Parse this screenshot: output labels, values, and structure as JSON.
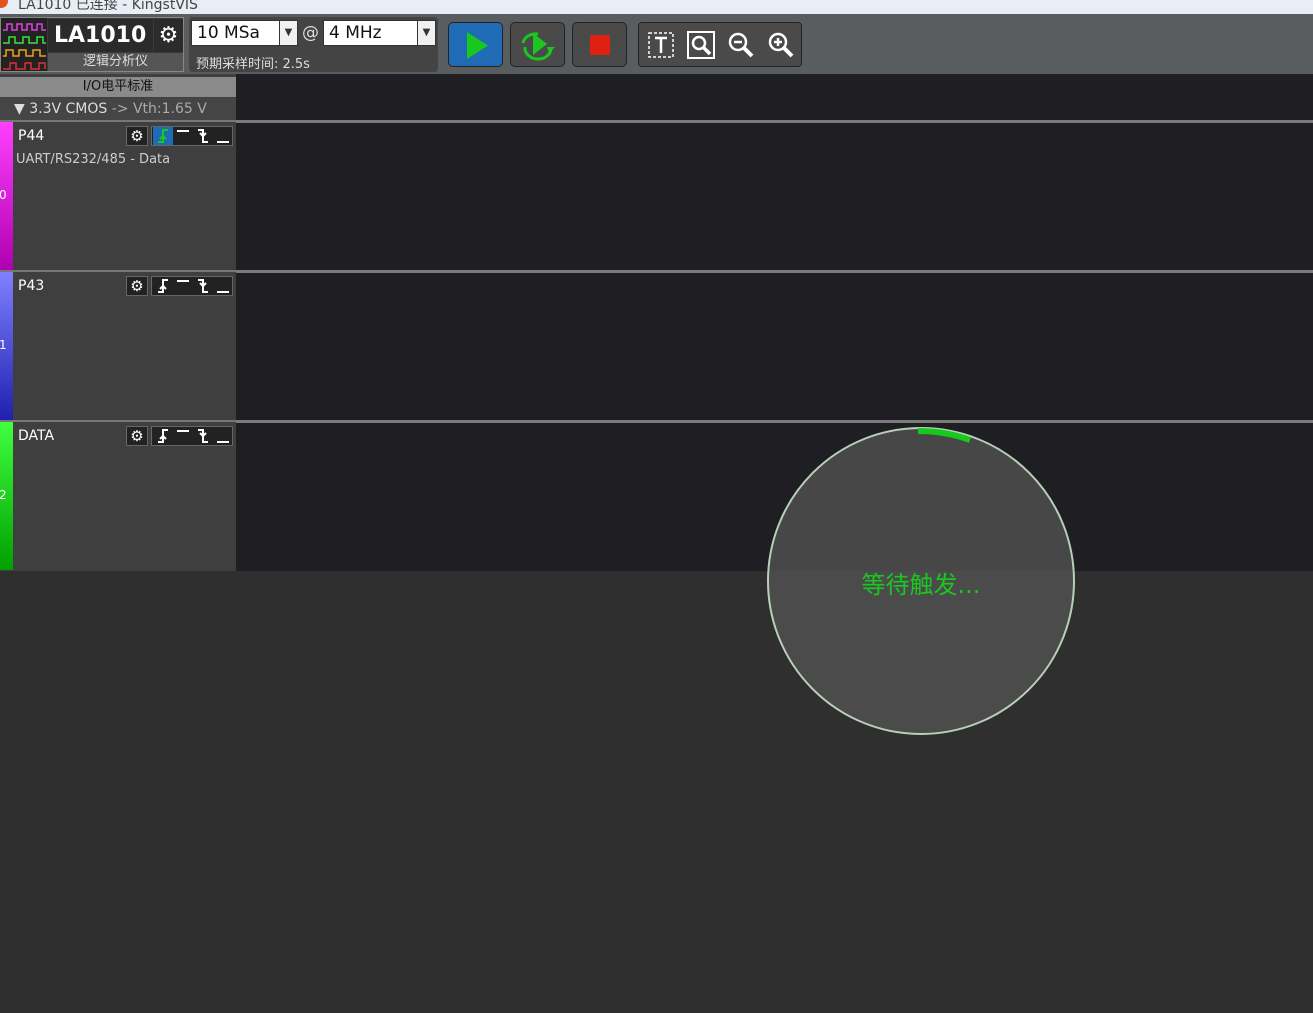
{
  "window": {
    "title": "LA1010 已连接 - KingstVIS"
  },
  "device": {
    "name": "LA1010",
    "subtitle": "逻辑分析仪"
  },
  "sampling": {
    "depth": "10 MSa",
    "at": "@",
    "rate": "4 MHz",
    "pre_time": "预期采样时间: 2.5s"
  },
  "io": {
    "header": "I/O电平标准",
    "standard": "3.3V CMOS",
    "vth": "-> Vth:1.65 V",
    "expand_glyph": "▼"
  },
  "channels": [
    {
      "index": "0",
      "name": "P44",
      "desc": "UART/RS232/485 - Data",
      "color_top": "#ff40ff",
      "color_bottom": "#b000b0",
      "active_trigger": "rising"
    },
    {
      "index": "1",
      "name": "P43",
      "desc": "",
      "color_top": "#8080ff",
      "color_bottom": "#2020b0",
      "active_trigger": "none"
    },
    {
      "index": "2",
      "name": "DATA",
      "desc": "",
      "color_top": "#40ff40",
      "color_bottom": "#00a000",
      "active_trigger": "none"
    }
  ],
  "status": {
    "waiting_text": "等待触发..."
  },
  "colors": {
    "accent_green": "#19c81e",
    "run_button_blue": "#1f6bb5",
    "stop_red": "#e02010"
  },
  "icons": {
    "gear": "gear-icon",
    "run": "play-icon",
    "loop": "loop-run-icon",
    "stop": "stop-icon",
    "text": "text-cursor-icon",
    "zoom_fit": "zoom-fit-icon",
    "zoom_out": "zoom-out-icon",
    "zoom_in": "zoom-in-icon"
  }
}
